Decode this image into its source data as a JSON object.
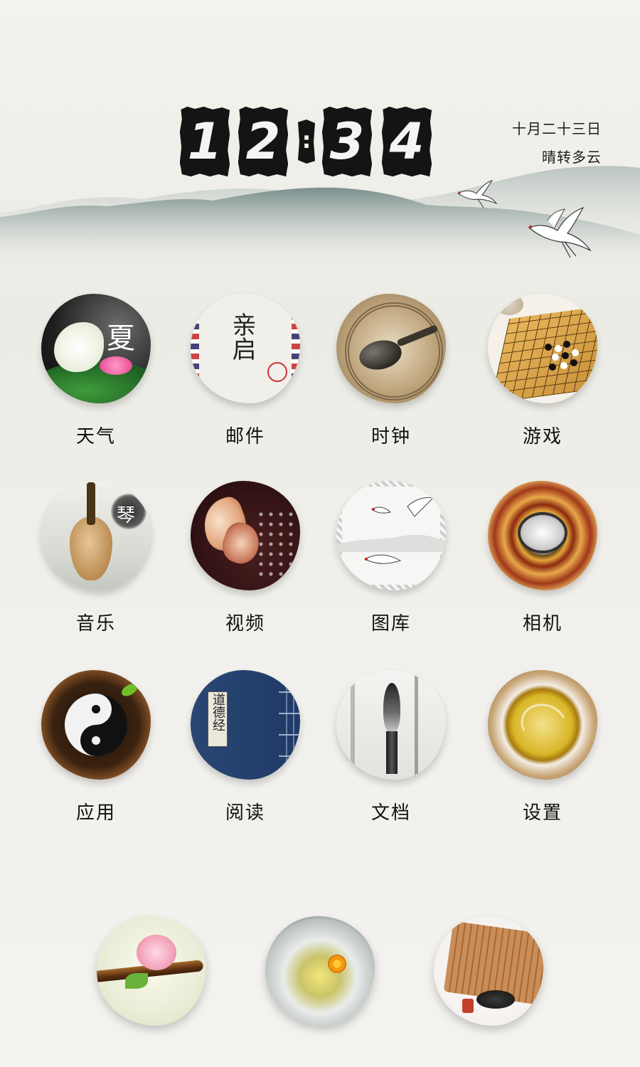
{
  "status": {
    "time_digits": [
      "1",
      "2",
      "3",
      "4"
    ],
    "colon": ":",
    "date": "十月二十三日",
    "weather": "晴转多云"
  },
  "apps": [
    {
      "label": "天气",
      "icon": "lotus-icon",
      "glyph": "夏"
    },
    {
      "label": "邮件",
      "icon": "envelope-icon",
      "glyph": "亲启"
    },
    {
      "label": "时钟",
      "icon": "compass-spoon-icon"
    },
    {
      "label": "游戏",
      "icon": "go-board-icon"
    },
    {
      "label": "音乐",
      "icon": "pipa-icon",
      "glyph": "琴"
    },
    {
      "label": "视频",
      "icon": "butterfly-icon"
    },
    {
      "label": "图库",
      "icon": "cranes-icon"
    },
    {
      "label": "相机",
      "icon": "bagua-icon"
    },
    {
      "label": "应用",
      "icon": "yin-yang-icon"
    },
    {
      "label": "阅读",
      "icon": "book-icon",
      "glyph": "道德经"
    },
    {
      "label": "文档",
      "icon": "brush-icon"
    },
    {
      "label": "设置",
      "icon": "tea-cup-icon"
    }
  ],
  "dock": [
    {
      "icon": "flute-blossom-icon"
    },
    {
      "icon": "chrysanthemum-tea-icon"
    },
    {
      "icon": "bamboo-scroll-icon"
    }
  ],
  "colors": {
    "background": "#efeee9",
    "ink": "#141414",
    "mountain": "#6f8582"
  }
}
